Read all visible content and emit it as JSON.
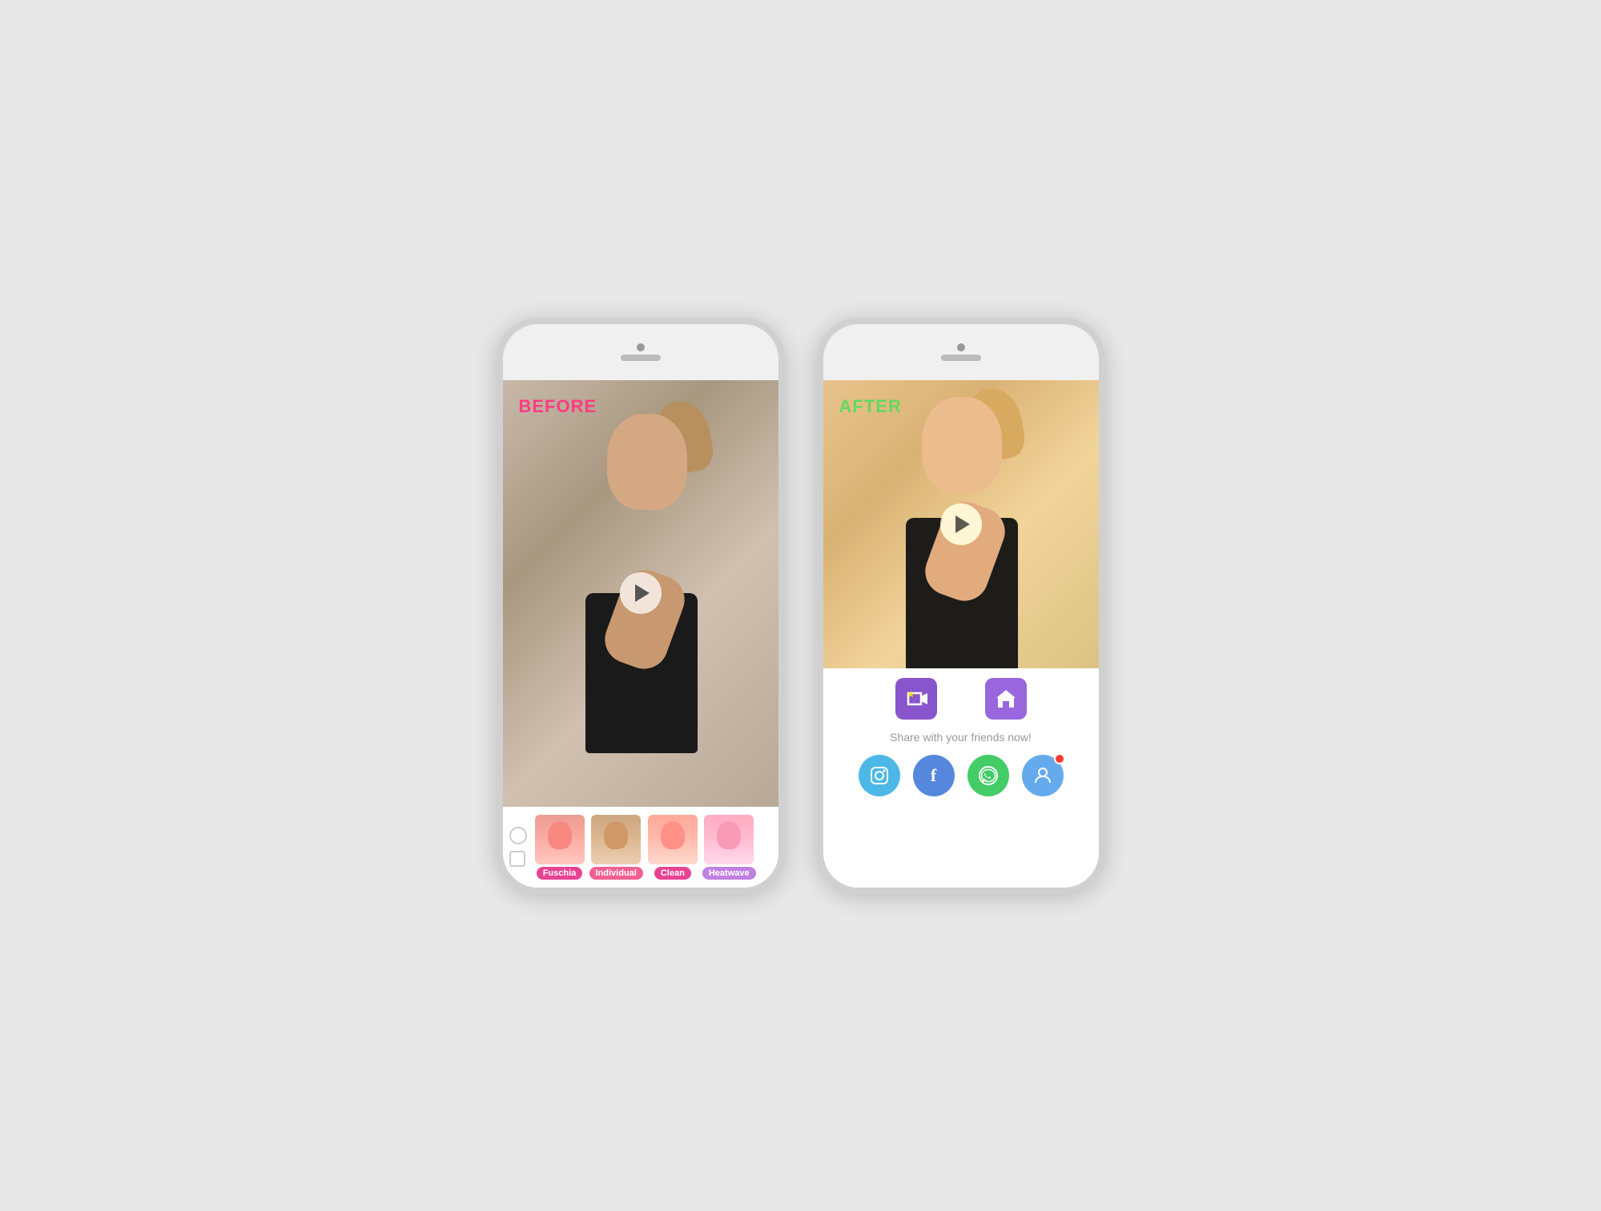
{
  "phones": {
    "before": {
      "label": "BEFORE",
      "label_color": "#ff3b82",
      "filters": [
        {
          "id": "fuschia",
          "label": "Fuschia",
          "color": "#e84393"
        },
        {
          "id": "individual",
          "label": "Individual",
          "color": "#f06090"
        },
        {
          "id": "clean",
          "label": "Clean",
          "color": "#e84393"
        },
        {
          "id": "heatwave",
          "label": "Heatwave",
          "color": "#c080e0"
        }
      ]
    },
    "after": {
      "label": "AFTER",
      "label_color": "#4cd964",
      "action_buttons": [
        {
          "id": "video-star",
          "icon": "⭐📹"
        },
        {
          "id": "home",
          "icon": "🏠"
        }
      ],
      "share_text": "Share with your friends now!",
      "social_buttons": [
        {
          "id": "instagram",
          "color": "#4db8e8",
          "icon": "📷"
        },
        {
          "id": "facebook",
          "color": "#5588dd",
          "icon": "f"
        },
        {
          "id": "whatsapp",
          "color": "#44cc66",
          "icon": "✆"
        },
        {
          "id": "person",
          "color": "#66aaee",
          "icon": "👤",
          "has_badge": true
        }
      ]
    }
  }
}
